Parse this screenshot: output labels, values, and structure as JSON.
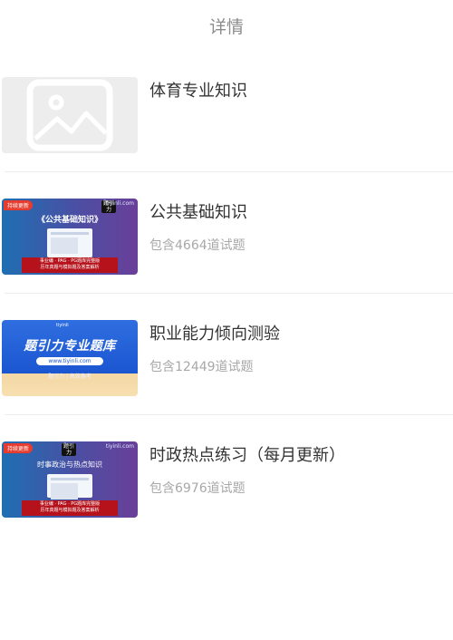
{
  "header": {
    "title": "详情"
  },
  "items": [
    {
      "title": "体育专业知识",
      "count": "",
      "thumb_kind": "placeholder-image-icon"
    },
    {
      "title": "公共基础知识",
      "count": "包含4664道试题",
      "thumb": {
        "tag": "持续更新",
        "brand": "tiyinli.com",
        "logo": "题引力",
        "banner_title": "《公共基础知识》",
        "bar_line1": "事业编 · PAG · PG题库完整版",
        "bar_line2": "历年真题与模拟题及答案解析"
      }
    },
    {
      "title": "职业能力倾向测验",
      "count": "包含12449道试题",
      "thumb": {
        "top_text": "tiyinli",
        "banner_title": "题引力专业题库",
        "url": "www.tiyinli.com",
        "sub": "题引力 | 高效备考"
      }
    },
    {
      "title": "时政热点练习（每月更新）",
      "count": "包含6976道试题",
      "thumb": {
        "tag": "持续更新",
        "brand": "tiyinli.com",
        "logo": "题引力",
        "banner_title": "时事政治与热点知识",
        "bar_line1": "事业编 · PAG · PG题库完整版",
        "bar_line2": "历年真题与模拟题及答案解析"
      }
    }
  ],
  "colors": {
    "divider": "#ececec",
    "title": "#333333",
    "muted": "#a8a8a8",
    "tag_red": "#e63b2e"
  }
}
